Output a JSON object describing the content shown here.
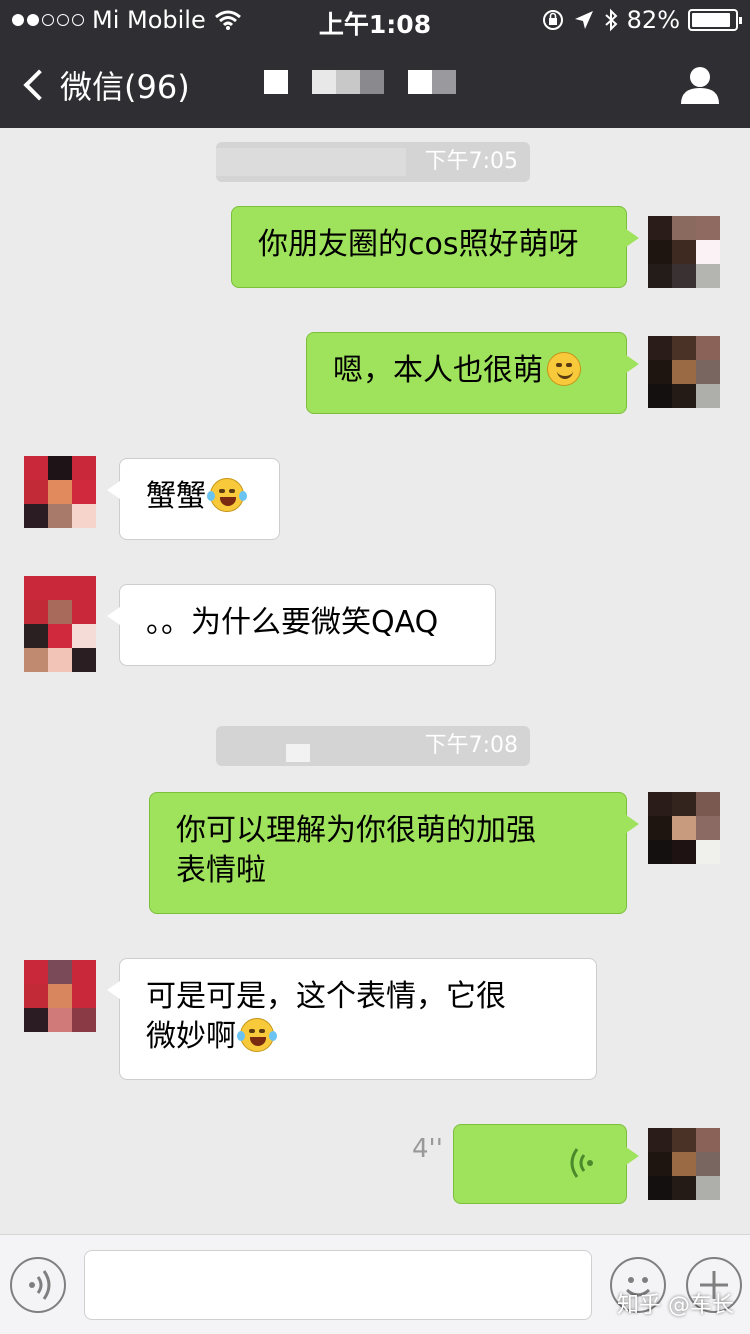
{
  "status_bar": {
    "carrier": "Mi Mobile",
    "time": "上午1:08",
    "battery": "82%",
    "signal_bars_filled": 2,
    "signal_bars_total": 5
  },
  "nav": {
    "back_label": "微信(96)",
    "profile_icon": "person-icon"
  },
  "messages": {
    "ts1": {
      "time": "下午7:05"
    },
    "m1": {
      "text": "你朋友圈的cos照好萌呀"
    },
    "m2": {
      "text": "嗯，本人也很萌"
    },
    "m3": {
      "text": "蟹蟹"
    },
    "m4": {
      "text": "。。为什么要微笑QAQ"
    },
    "ts2": {
      "time": "下午7:08"
    },
    "m5": {
      "line1": "你可以理解为你很萌的加强",
      "line2": "表情啦"
    },
    "m6": {
      "line1": "可是可是，这个表情，它很",
      "line2": "微妙啊"
    },
    "m7": {
      "duration": "4''"
    }
  },
  "input_bar": {
    "voice_icon": "voice-mode-icon",
    "emoji_icon": "emoji-icon",
    "plus_icon": "plus-icon"
  },
  "watermark": "知乎 @车长",
  "colors": {
    "header_bg": "#2e2e33",
    "chat_bg": "#ebebeb",
    "outgoing_bubble": "#9fe35d",
    "incoming_bubble": "#ffffff"
  }
}
